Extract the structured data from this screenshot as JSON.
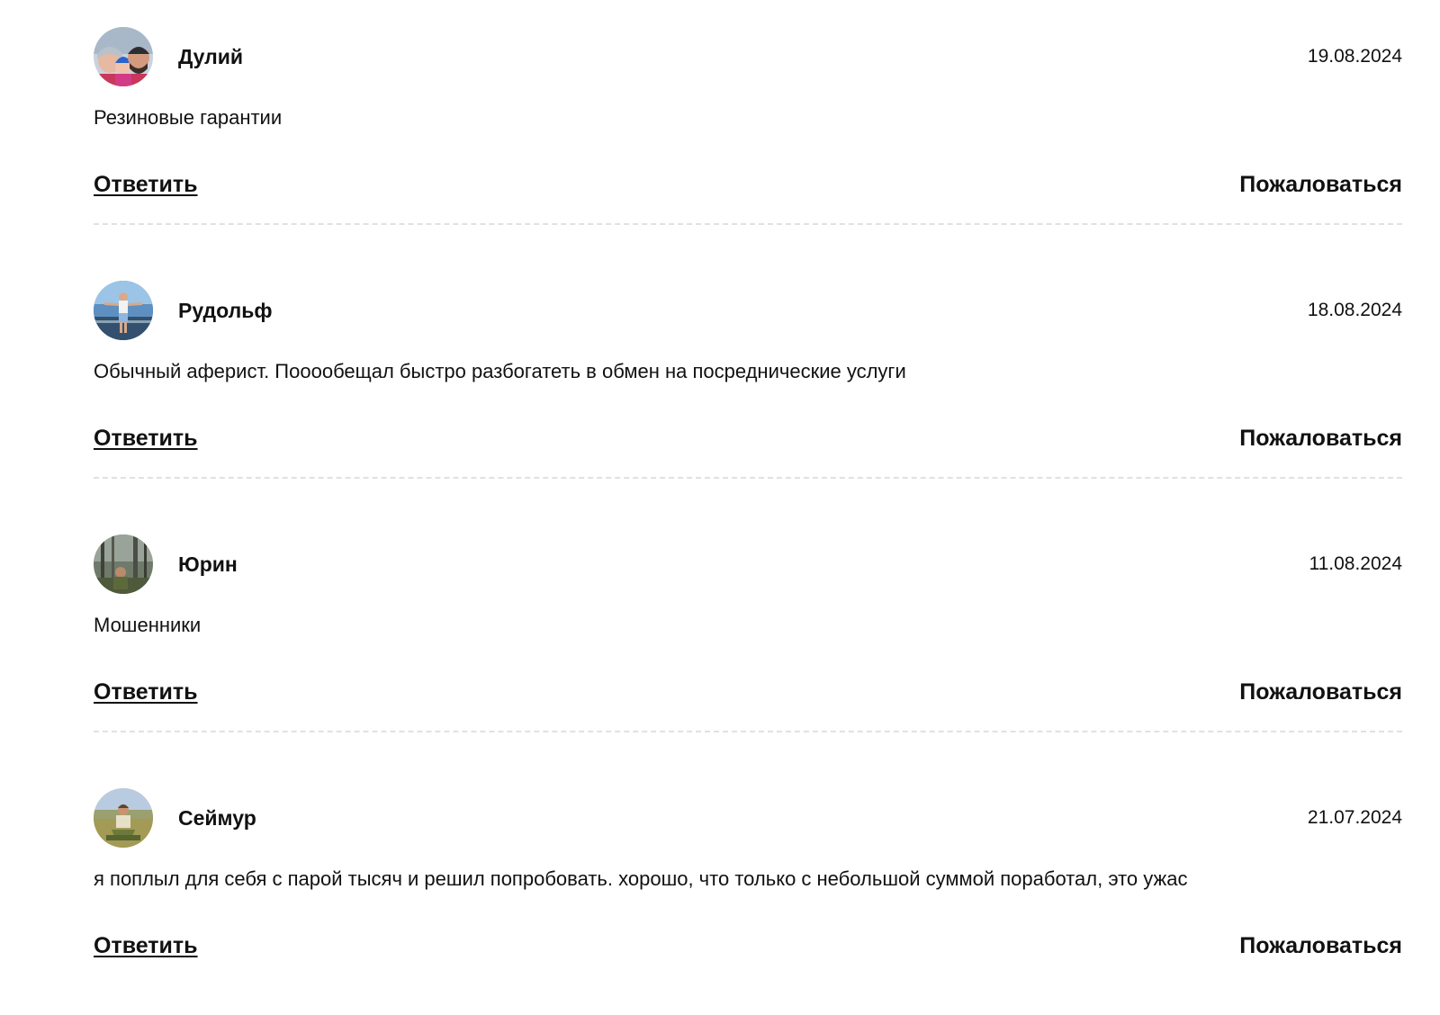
{
  "comments": [
    {
      "author": "Дулий",
      "date": "19.08.2024",
      "text": "Резиновые гарантии",
      "reply_label": "Ответить",
      "report_label": "Пожаловаться",
      "avatar_icon": "avatar-photo-family"
    },
    {
      "author": "Рудольф",
      "date": "18.08.2024",
      "text": "Обычный аферист. Пооообещал быстро разбогатеть в обмен на посреднические услуги",
      "reply_label": "Ответить",
      "report_label": "Пожаловаться",
      "avatar_icon": "avatar-photo-seaside"
    },
    {
      "author": "Юрин",
      "date": "11.08.2024",
      "text": "Мошенники",
      "reply_label": "Ответить",
      "report_label": "Пожаловаться",
      "avatar_icon": "avatar-photo-forest"
    },
    {
      "author": "Сеймур",
      "date": "21.07.2024",
      "text": "я поплыл для себя с парой тысяч и решил попробовать. хорошо, что только с небольшой суммой поработал, это ужас",
      "reply_label": "Ответить",
      "report_label": "Пожаловаться",
      "avatar_icon": "avatar-photo-field"
    }
  ],
  "colors": {
    "text": "#111111",
    "divider": "#e1e1e1",
    "background": "#ffffff"
  }
}
